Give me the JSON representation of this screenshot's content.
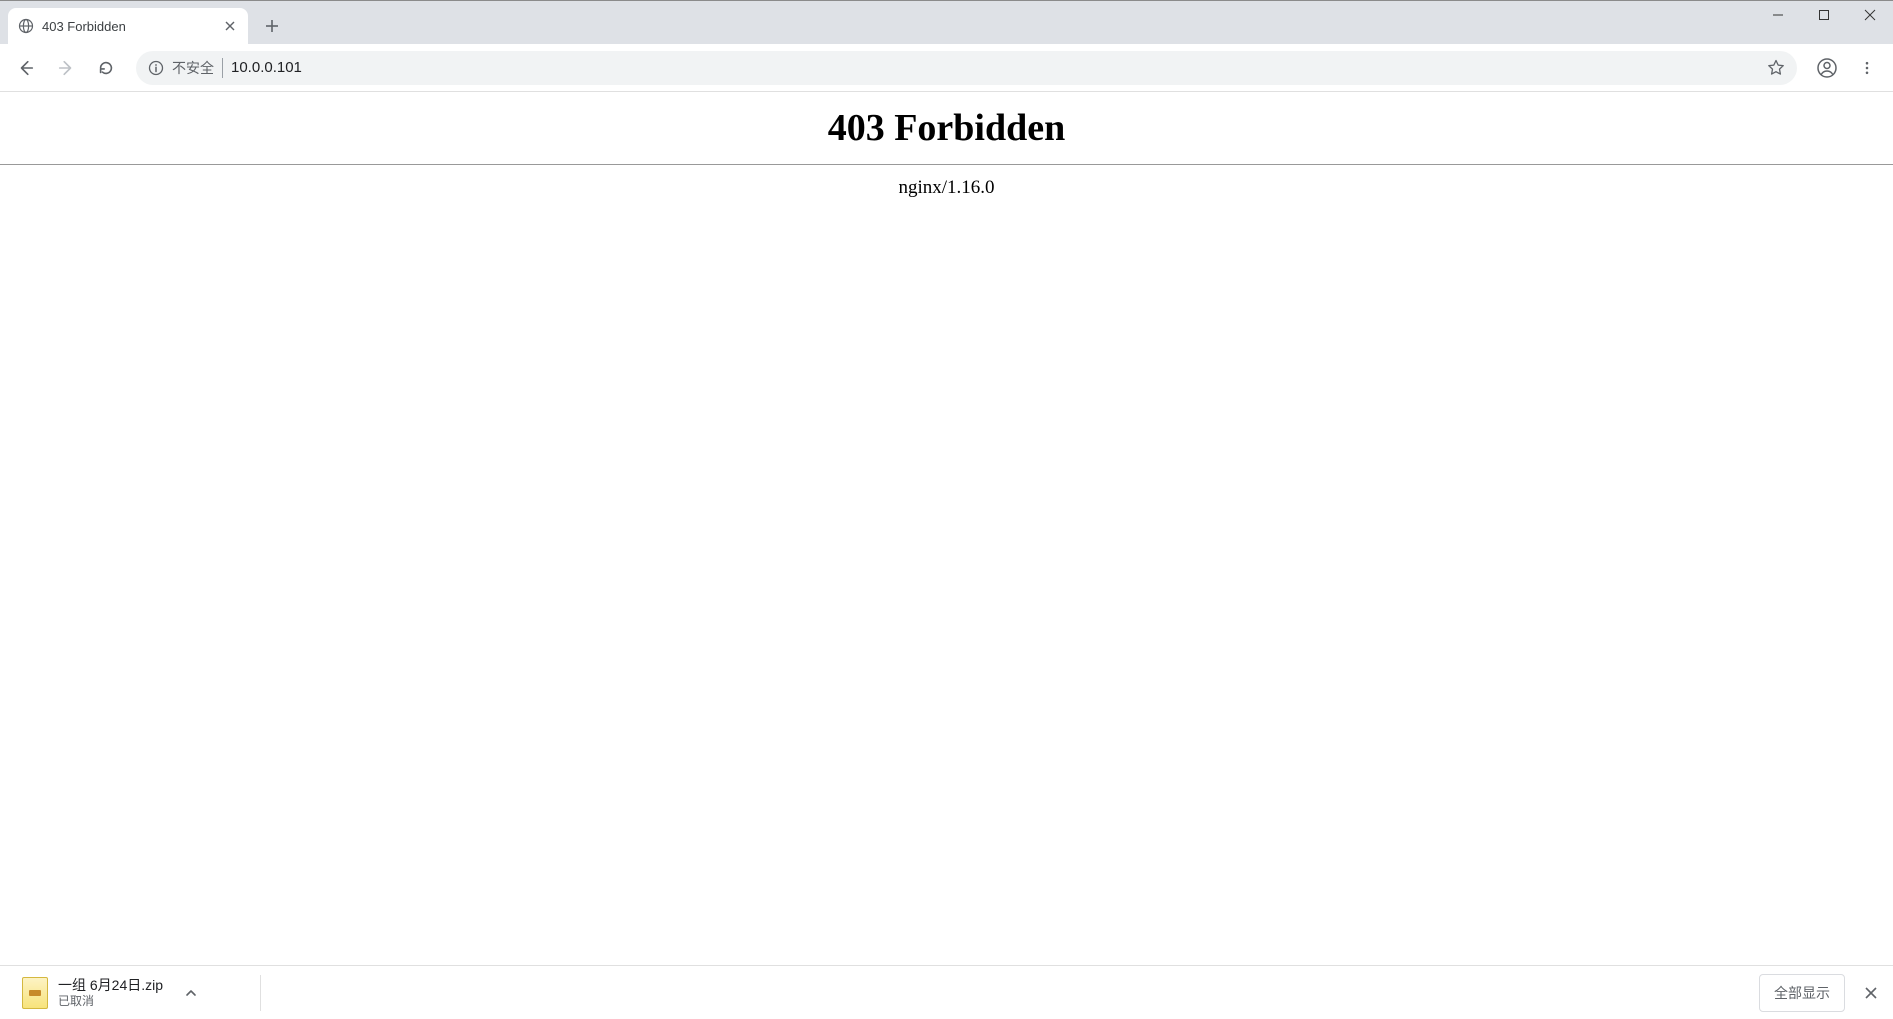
{
  "tab": {
    "title": "403 Forbidden"
  },
  "omnibox": {
    "security_label": "不安全",
    "url": "10.0.0.101"
  },
  "page": {
    "heading": "403 Forbidden",
    "server": "nginx/1.16.0"
  },
  "downloads": {
    "filename": "一组 6月24日.zip",
    "status": "已取消",
    "show_all_label": "全部显示"
  }
}
